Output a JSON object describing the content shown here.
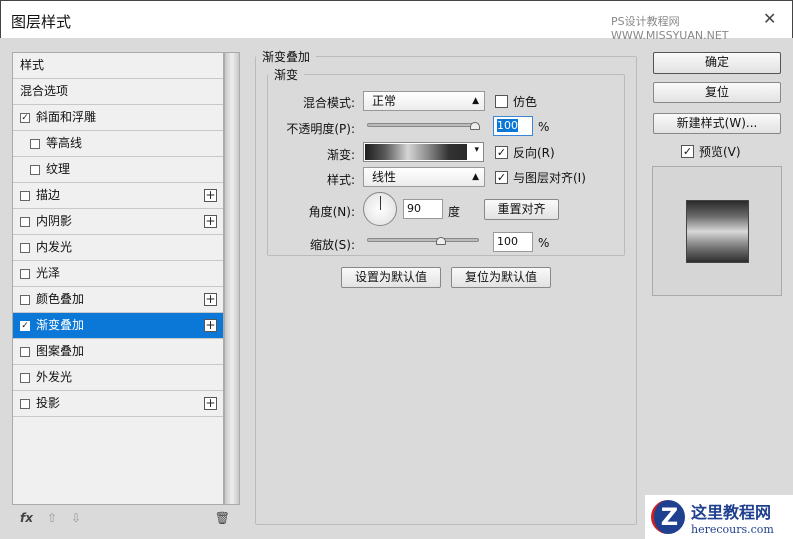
{
  "window": {
    "title": "图层样式",
    "watermark": "PS设计教程网  WWW.MISSYUAN.NET",
    "close": "✕"
  },
  "sidebar": {
    "items": [
      {
        "label": "样式",
        "checkbox": false,
        "checked": false,
        "plus": false,
        "indent": false
      },
      {
        "label": "混合选项",
        "checkbox": false,
        "checked": false,
        "plus": false,
        "indent": false
      },
      {
        "label": "斜面和浮雕",
        "checkbox": true,
        "checked": true,
        "plus": false,
        "indent": false
      },
      {
        "label": "等高线",
        "checkbox": true,
        "checked": false,
        "plus": false,
        "indent": true
      },
      {
        "label": "纹理",
        "checkbox": true,
        "checked": false,
        "plus": false,
        "indent": true
      },
      {
        "label": "描边",
        "checkbox": true,
        "checked": false,
        "plus": true,
        "indent": false
      },
      {
        "label": "内阴影",
        "checkbox": true,
        "checked": false,
        "plus": true,
        "indent": false
      },
      {
        "label": "内发光",
        "checkbox": true,
        "checked": false,
        "plus": false,
        "indent": false
      },
      {
        "label": "光泽",
        "checkbox": true,
        "checked": false,
        "plus": false,
        "indent": false
      },
      {
        "label": "颜色叠加",
        "checkbox": true,
        "checked": false,
        "plus": true,
        "indent": false
      },
      {
        "label": "渐变叠加",
        "checkbox": true,
        "checked": true,
        "plus": true,
        "indent": false,
        "selected": true
      },
      {
        "label": "图案叠加",
        "checkbox": true,
        "checked": false,
        "plus": false,
        "indent": false
      },
      {
        "label": "外发光",
        "checkbox": true,
        "checked": false,
        "plus": false,
        "indent": false
      },
      {
        "label": "投影",
        "checkbox": true,
        "checked": false,
        "plus": true,
        "indent": false
      }
    ],
    "toolbar": {
      "fx": "fx",
      "up": "⇧",
      "down": "⇩",
      "trash": "🗑"
    }
  },
  "panel": {
    "section": "渐变叠加",
    "group": "渐变",
    "blend_label": "混合模式:",
    "blend_value": "正常",
    "dither": "仿色",
    "opacity_label": "不透明度(P):",
    "opacity": "100",
    "opacity_value": 100,
    "pct": "%",
    "gradient_label": "渐变:",
    "reverse": "反向(R)",
    "style_label": "样式:",
    "style_value": "线性",
    "align": "与图层对齐(I)",
    "angle_label": "角度(N):",
    "angle": "90",
    "deg": "度",
    "reset_align": "重置对齐",
    "scale_label": "缩放(S):",
    "scale": "100",
    "scale_value": 100,
    "set_default": "设置为默认值",
    "reset_default": "复位为默认值"
  },
  "right": {
    "ok": "确定",
    "reset": "复位",
    "new_style": "新建样式(W)...",
    "preview": "预览(V)"
  },
  "logo": {
    "name": "这里教程网",
    "url": "herecours.com"
  },
  "colors": {
    "selected": "#0b78d7"
  }
}
